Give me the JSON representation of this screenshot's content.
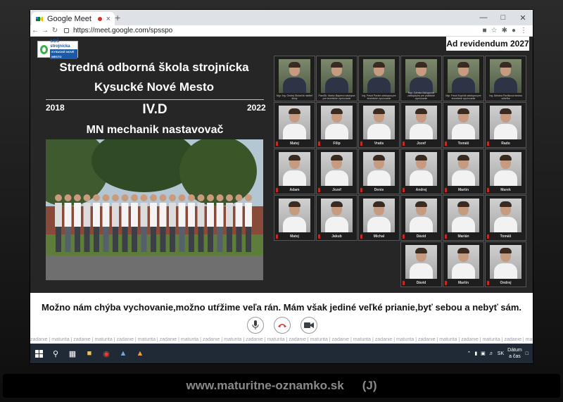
{
  "browser": {
    "tab_title": "Google Meet",
    "url": "https://meet.google.com/spsspo",
    "close_glyph": "×",
    "newtab_glyph": "+"
  },
  "tableau": {
    "logo_line1": "SOŠ strojnícka",
    "logo_line2": "KYSUCKÉ NOVÉ MESTO",
    "school_name": "Stredná odborná škola strojnícka",
    "school_town": "Kysucké Nové Mesto",
    "year_start": "2018",
    "year_end": "2022",
    "class_name": "IV.D",
    "field": "MN mechanik nastavovač",
    "motto": "Ad revidendum 2027",
    "teachers": [
      "Mgr. Ing. Ondrej Stolarčík riaditeľ školy",
      "PaedDr. Marko Bajcerol zástupca pre teoretické vyučovanie",
      "Ing. Pavol Pavlen zástupca pre teoretické vyučovanie",
      "Mgr. Zdenka Baľuppová zástupkyňa pre praktické vyučovanie",
      "Mgr. Pavol Kopčák zástupca pre teoretické vyučovanie",
      "Ing. Adriana Pavlíková triedna učiteľka"
    ],
    "students": [
      [
        "Matej",
        "Filip",
        "Vratis",
        "Jozef",
        "Tomáš",
        "Rado"
      ],
      [
        "Adam",
        "Jozef",
        "Denis",
        "Andrej",
        "Martin",
        "Marek"
      ],
      [
        "Matej",
        "Jakub",
        "Michal",
        "Dávid",
        "Marián",
        "Tomáš"
      ],
      [
        "Dávid",
        "Martin",
        "Ondrej"
      ]
    ],
    "quote": "Možno nám chýba vychovanie,možno utŕžime veľa rán. Mám však jediné veľké prianie,byť sebou a nebyť sám.",
    "tags": "zadanie | maturita | zadanie | maturita | zadanie | maturita | zadanie | maturita | zadanie | maturita | zadanie | maturita | zadanie | maturita | zadanie | maturita | zadanie | maturita | zadanie | maturita | zadanie | maturita | zadanie | maturita"
  },
  "call_controls": {
    "mic_icon": "microphone-icon",
    "hangup_icon": "hang-up-icon",
    "camera_icon": "camera-icon",
    "hangup_color": "#d93025"
  },
  "taskbar": {
    "lang": "SK",
    "clock_line1": "Dátum",
    "clock_line2": "a čas"
  },
  "footer": {
    "site": "www.maturitne-oznamko.sk",
    "mark": "(J)"
  }
}
